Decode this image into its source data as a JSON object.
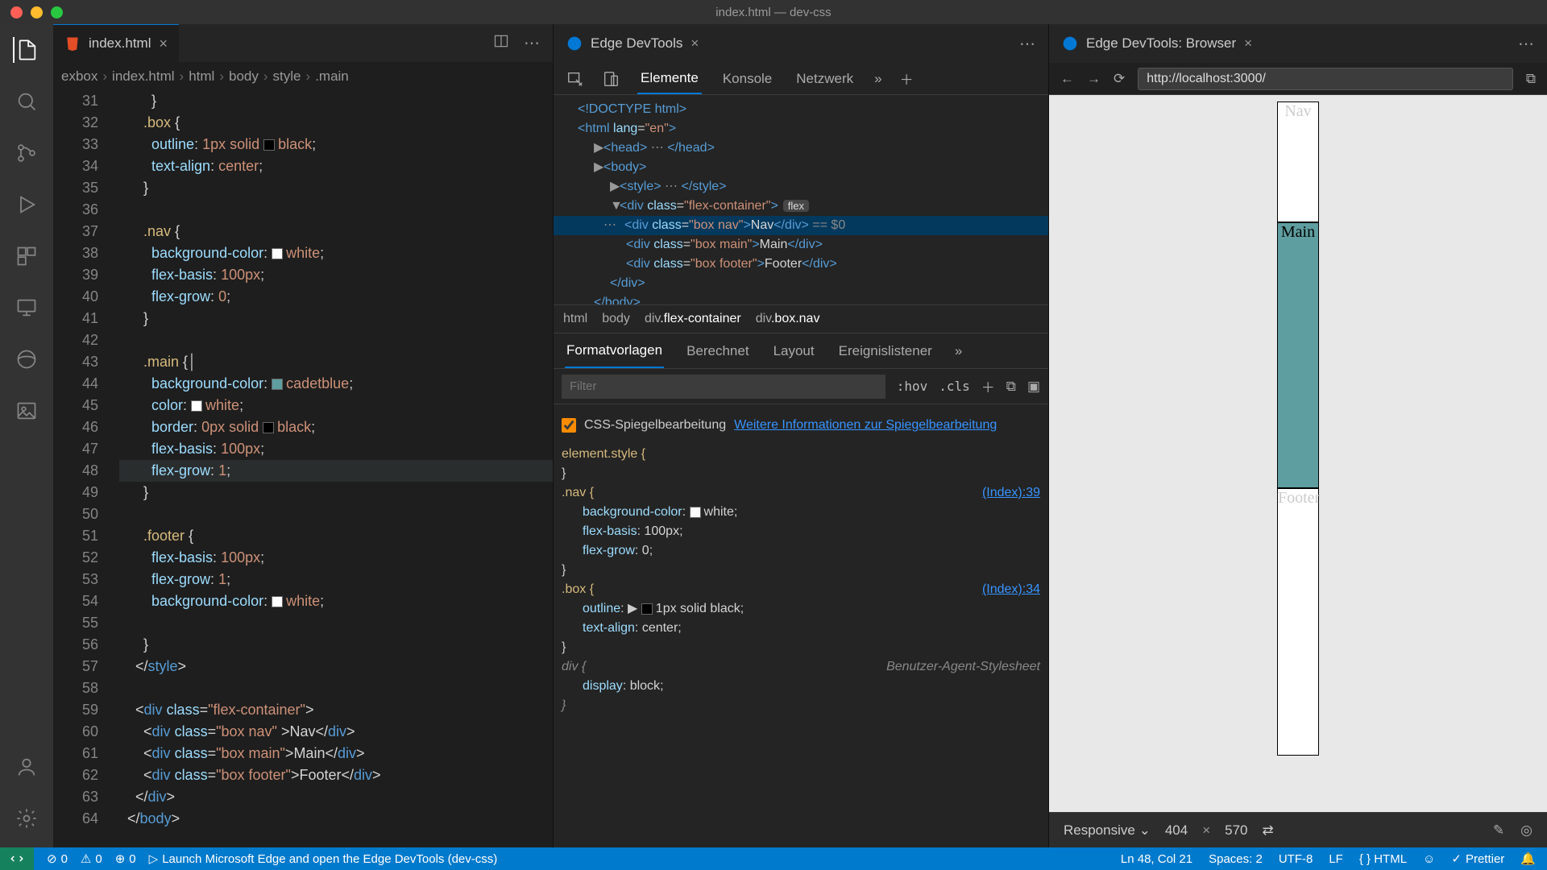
{
  "window": {
    "title": "index.html — dev-css"
  },
  "traffic": {
    "close": "#ff5f57",
    "min": "#febc2e",
    "max": "#28c840"
  },
  "editor": {
    "tab": {
      "label": "index.html"
    },
    "breadcrumb": [
      "exbox",
      "index.html",
      "html",
      "body",
      "style",
      ".main"
    ],
    "lines": [
      {
        "n": 31,
        "html": "        <span class='tk-punc'>}</span>"
      },
      {
        "n": 32,
        "html": "      <span class='tk-sel'>.box</span> <span class='tk-punc'>{</span>"
      },
      {
        "n": 33,
        "html": "        <span class='tk-prop'>outline</span>: <span class='tk-val'>1px solid </span><span class='swatch' style='background:black'></span><span class='tk-val'>black</span>;"
      },
      {
        "n": 34,
        "html": "        <span class='tk-prop'>text-align</span>: <span class='tk-val'>center</span>;"
      },
      {
        "n": 35,
        "html": "      <span class='tk-punc'>}</span>"
      },
      {
        "n": 36,
        "html": ""
      },
      {
        "n": 37,
        "html": "      <span class='tk-sel'>.nav</span> <span class='tk-punc'>{</span>"
      },
      {
        "n": 38,
        "html": "        <span class='tk-prop'>background-color</span>: <span class='swatch' style='background:white'></span><span class='tk-val'>white</span>;"
      },
      {
        "n": 39,
        "html": "        <span class='tk-prop'>flex-basis</span>: <span class='tk-val'>100px</span>;"
      },
      {
        "n": 40,
        "html": "        <span class='tk-prop'>flex-grow</span>: <span class='tk-val'>0</span>;"
      },
      {
        "n": 41,
        "html": "      <span class='tk-punc'>}</span>"
      },
      {
        "n": 42,
        "html": ""
      },
      {
        "n": 43,
        "html": "      <span class='tk-sel'>.main</span> <span class='tk-punc'>{</span>│"
      },
      {
        "n": 44,
        "html": "        <span class='tk-prop'>background-color</span>: <span class='swatch' style='background:cadetblue'></span><span class='tk-val'>cadetblue</span>;"
      },
      {
        "n": 45,
        "html": "        <span class='tk-prop'>color</span>: <span class='swatch' style='background:white'></span><span class='tk-val'>white</span>;"
      },
      {
        "n": 46,
        "html": "        <span class='tk-prop'>border</span>: <span class='tk-val'>0px solid </span><span class='swatch' style='background:black'></span><span class='tk-val'>black</span>;"
      },
      {
        "n": 47,
        "html": "        <span class='tk-prop'>flex-basis</span>: <span class='tk-val'>100px</span>;"
      },
      {
        "n": 48,
        "hl": true,
        "html": "        <span class='tk-prop'>flex-grow</span>: <span class='tk-val'>1</span>;"
      },
      {
        "n": 49,
        "html": "      <span class='tk-punc'>}</span>"
      },
      {
        "n": 50,
        "html": ""
      },
      {
        "n": 51,
        "html": "      <span class='tk-sel'>.footer</span> <span class='tk-punc'>{</span>"
      },
      {
        "n": 52,
        "html": "        <span class='tk-prop'>flex-basis</span>: <span class='tk-val'>100px</span>;"
      },
      {
        "n": 53,
        "html": "        <span class='tk-prop'>flex-grow</span>: <span class='tk-val'>1</span>;"
      },
      {
        "n": 54,
        "html": "        <span class='tk-prop'>background-color</span>: <span class='swatch' style='background:white'></span><span class='tk-val'>white</span>;"
      },
      {
        "n": 55,
        "html": ""
      },
      {
        "n": 56,
        "html": "      <span class='tk-punc'>}</span>"
      },
      {
        "n": 57,
        "html": "    <span class='tk-punc'>&lt;/</span><span class='tk-tag'>style</span><span class='tk-punc'>&gt;</span>"
      },
      {
        "n": 58,
        "html": ""
      },
      {
        "n": 59,
        "html": "    <span class='tk-punc'>&lt;</span><span class='tk-tag'>div</span> <span class='tk-attr'>class</span>=<span class='tk-str'>\"flex-container\"</span><span class='tk-punc'>&gt;</span>"
      },
      {
        "n": 60,
        "html": "      <span class='tk-punc'>&lt;</span><span class='tk-tag'>div</span> <span class='tk-attr'>class</span>=<span class='tk-str'>\"box nav\"</span> <span class='tk-punc'>&gt;</span><span class='tk-text'>Nav</span><span class='tk-punc'>&lt;/</span><span class='tk-tag'>div</span><span class='tk-punc'>&gt;</span>"
      },
      {
        "n": 61,
        "html": "      <span class='tk-punc'>&lt;</span><span class='tk-tag'>div</span> <span class='tk-attr'>class</span>=<span class='tk-str'>\"box main\"</span><span class='tk-punc'>&gt;</span><span class='tk-text'>Main</span><span class='tk-punc'>&lt;/</span><span class='tk-tag'>div</span><span class='tk-punc'>&gt;</span>"
      },
      {
        "n": 62,
        "html": "      <span class='tk-punc'>&lt;</span><span class='tk-tag'>div</span> <span class='tk-attr'>class</span>=<span class='tk-str'>\"box footer\"</span><span class='tk-punc'>&gt;</span><span class='tk-text'>Footer</span><span class='tk-punc'>&lt;/</span><span class='tk-tag'>div</span><span class='tk-punc'>&gt;</span>"
      },
      {
        "n": 63,
        "html": "    <span class='tk-punc'>&lt;/</span><span class='tk-tag'>div</span><span class='tk-punc'>&gt;</span>"
      },
      {
        "n": 64,
        "html": "  <span class='tk-punc'>&lt;/</span><span class='tk-tag'>body</span><span class='tk-punc'>&gt;</span>"
      }
    ]
  },
  "devtools": {
    "tab": "Edge DevTools",
    "tool_tabs": [
      "Elemente",
      "Konsole",
      "Netzwerk"
    ],
    "dom": [
      {
        "indent": 0,
        "html": "<span class='dom-tag'>&lt;!DOCTYPE html&gt;</span>"
      },
      {
        "indent": 0,
        "html": "<span class='dom-tag'>&lt;html</span> <span class='dom-attr'>lang</span>=<span class='dom-str'>\"en\"</span><span class='dom-tag'>&gt;</span>"
      },
      {
        "indent": 1,
        "tri": "▶",
        "html": "<span class='dom-tag'>&lt;head&gt;</span> <span class='dom-dim'>⋯</span> <span class='dom-tag'>&lt;/head&gt;</span>"
      },
      {
        "indent": 1,
        "tri": "▶",
        "html": "<span class='dom-tag'>&lt;body&gt;</span>"
      },
      {
        "indent": 2,
        "tri": "▶",
        "html": "<span class='dom-tag'>&lt;style&gt;</span> <span class='dom-dim'>⋯</span> <span class='dom-tag'>&lt;/style&gt;</span>"
      },
      {
        "indent": 2,
        "tri": "▼",
        "html": "<span class='dom-tag'>&lt;div</span> <span class='dom-attr'>class</span>=<span class='dom-str'>\"flex-container\"</span><span class='dom-tag'>&gt;</span><span class='dom-pill'>flex</span>"
      },
      {
        "indent": 3,
        "sel": true,
        "pre": "⋯",
        "html": "<span class='dom-tag'>&lt;div</span> <span class='dom-attr'>class</span>=<span class='dom-str'>\"box nav\"</span><span class='dom-tag'>&gt;</span>Nav<span class='dom-tag'>&lt;/div&gt;</span> <span class='dom-dim'>== $0</span>"
      },
      {
        "indent": 3,
        "html": "<span class='dom-tag'>&lt;div</span> <span class='dom-attr'>class</span>=<span class='dom-str'>\"box main\"</span><span class='dom-tag'>&gt;</span>Main<span class='dom-tag'>&lt;/div&gt;</span>"
      },
      {
        "indent": 3,
        "html": "<span class='dom-tag'>&lt;div</span> <span class='dom-attr'>class</span>=<span class='dom-str'>\"box footer\"</span><span class='dom-tag'>&gt;</span>Footer<span class='dom-tag'>&lt;/div&gt;</span>"
      },
      {
        "indent": 2,
        "html": "<span class='dom-tag'>&lt;/div&gt;</span>"
      },
      {
        "indent": 1,
        "html": "<span class='dom-tag'>&lt;/body&gt;</span>"
      }
    ],
    "crumbs": [
      "html",
      "body",
      "div.flex-container",
      "div.box.nav"
    ],
    "style_tabs": [
      "Formatvorlagen",
      "Berechnet",
      "Layout",
      "Ereignislistener"
    ],
    "filter_placeholder": "Filter",
    "hov": ":hov",
    "cls": ".cls",
    "mirror_label": "CSS-Spiegelbearbeitung",
    "mirror_link": "Weitere Informationen zur Spiegelbearbeitung",
    "rules": [
      {
        "sel": "element.style {",
        "src": "",
        "props": [],
        "close": "}"
      },
      {
        "sel": ".nav {",
        "src": "(Index):39",
        "props": [
          {
            "p": "background-color",
            "v": "white",
            "sw": "white"
          },
          {
            "p": "flex-basis",
            "v": "100px"
          },
          {
            "p": "flex-grow",
            "v": "0"
          }
        ],
        "close": "}"
      },
      {
        "sel": ".box {",
        "src": "(Index):34",
        "props": [
          {
            "p": "outline",
            "v": "1px solid black",
            "sw": "black",
            "tri": true
          },
          {
            "p": "text-align",
            "v": "center"
          }
        ],
        "close": "}"
      },
      {
        "sel": "div {",
        "src": "Benutzer-Agent-Stylesheet",
        "dim": true,
        "props": [
          {
            "p": "display",
            "v": "block"
          }
        ],
        "close": "}"
      }
    ]
  },
  "browser": {
    "tab": "Edge DevTools: Browser",
    "url": "http://localhost:3000/",
    "boxes": {
      "nav": "Nav",
      "main": "Main",
      "footer": "Footer"
    },
    "device": "Responsive",
    "w": "404",
    "h": "570"
  },
  "status": {
    "errors": "0",
    "warnings": "0",
    "port": "0",
    "launch": "Launch Microsoft Edge and open the Edge DevTools (dev-css)",
    "cursor": "Ln 48, Col 21",
    "spaces": "Spaces: 2",
    "enc": "UTF-8",
    "eol": "LF",
    "lang": "HTML",
    "prettier": "Prettier"
  }
}
